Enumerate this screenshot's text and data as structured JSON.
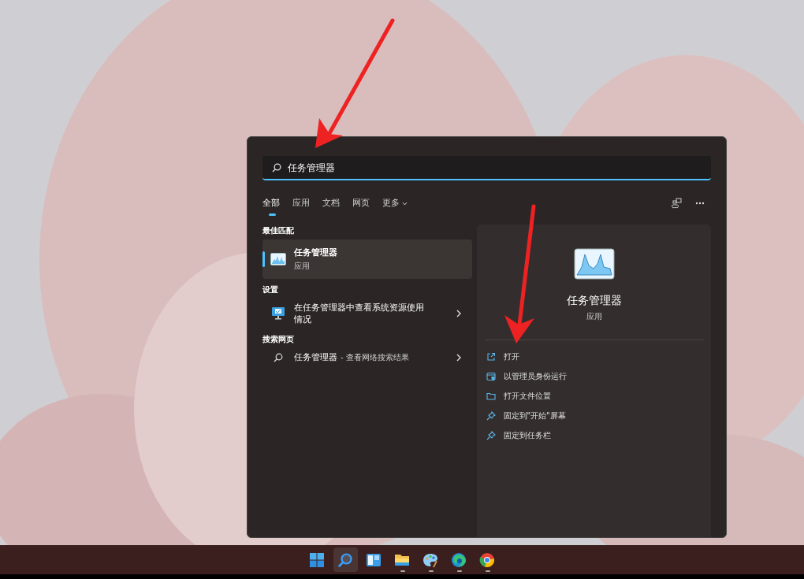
{
  "search": {
    "value": "任务管理器"
  },
  "tabs": [
    {
      "label": "全部",
      "selected": true,
      "kind": "plain"
    },
    {
      "label": "应用",
      "selected": false,
      "kind": "plain"
    },
    {
      "label": "文档",
      "selected": false,
      "kind": "plain"
    },
    {
      "label": "网页",
      "selected": false,
      "kind": "plain"
    },
    {
      "label": "更多",
      "selected": false,
      "kind": "dropdown"
    }
  ],
  "sections": [
    {
      "heading": "最佳匹配",
      "items": [
        {
          "kind": "app",
          "title": "任务管理器",
          "subtitle": "应用",
          "selected": true
        }
      ]
    },
    {
      "heading": "设置",
      "items": [
        {
          "kind": "setting",
          "title": "在任务管理器中查看系统资源使用情况",
          "selected": false
        }
      ]
    },
    {
      "heading": "搜索网页",
      "items": [
        {
          "kind": "web",
          "title": "任务管理器",
          "suffix": "- 查看网络搜索结果",
          "selected": false
        }
      ]
    }
  ],
  "detail": {
    "title": "任务管理器",
    "subtitle": "应用",
    "actions": [
      {
        "kind": "open",
        "label": "打开"
      },
      {
        "kind": "admin",
        "label": "以管理员身份运行"
      },
      {
        "kind": "folder",
        "label": "打开文件位置"
      },
      {
        "kind": "pin",
        "label": "固定到\"开始\"屏幕"
      },
      {
        "kind": "pin",
        "label": "固定到任务栏"
      }
    ]
  },
  "taskbar": [
    {
      "kind": "start",
      "selected": false,
      "running": false
    },
    {
      "kind": "search",
      "selected": true,
      "running": false
    },
    {
      "kind": "widgets",
      "selected": false,
      "running": false
    },
    {
      "kind": "explorer",
      "selected": false,
      "running": true
    },
    {
      "kind": "paint",
      "selected": false,
      "running": true
    },
    {
      "kind": "edge",
      "selected": false,
      "running": true
    },
    {
      "kind": "chrome",
      "selected": false,
      "running": true
    }
  ]
}
